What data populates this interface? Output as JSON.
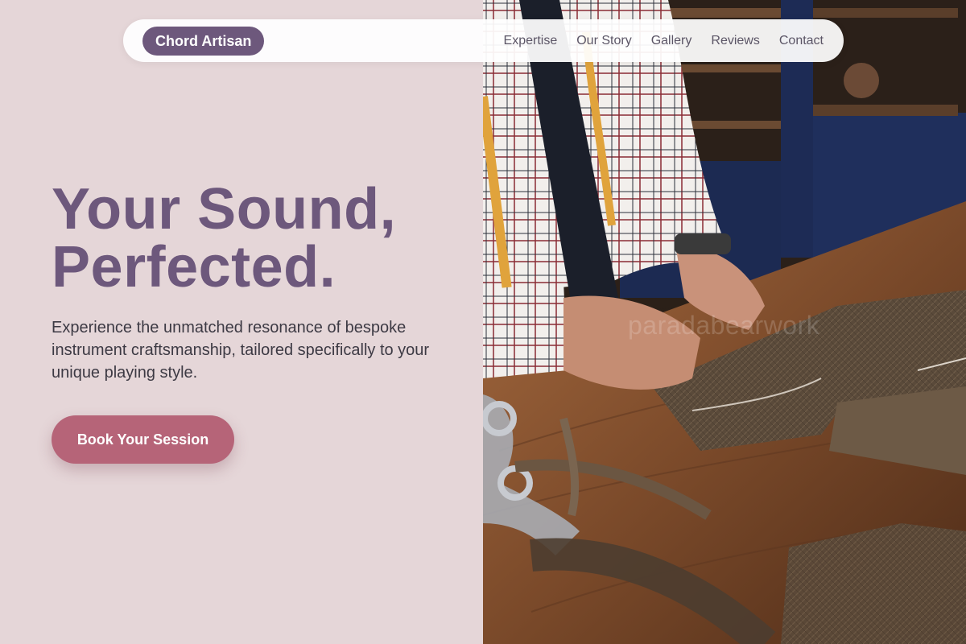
{
  "brand": {
    "label": "Chord Artisan"
  },
  "nav": {
    "links": [
      {
        "label": "Expertise"
      },
      {
        "label": "Our Story"
      },
      {
        "label": "Gallery"
      },
      {
        "label": "Reviews"
      },
      {
        "label": "Contact"
      }
    ]
  },
  "hero": {
    "title_line1": "Your Sound,",
    "title_line2": "Perfected.",
    "subtitle": "Experience the unmatched resonance of bespoke instrument craftsmanship, tailored specifically to your unique playing style.",
    "cta_label": "Book Your Session"
  },
  "image": {
    "watermark": "paradabearwork"
  },
  "colors": {
    "accent": "#6d587c",
    "cta": "#b66478",
    "background": "#e5d6d8"
  }
}
